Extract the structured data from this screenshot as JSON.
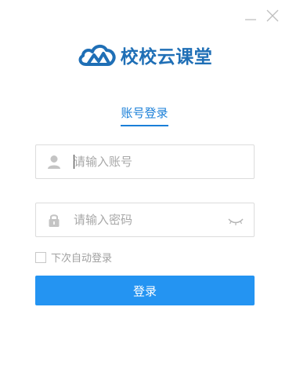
{
  "window": {
    "controls": {
      "minimize_icon": "minimize-icon",
      "close_icon": "close-icon"
    }
  },
  "logo": {
    "text": "校校云课堂",
    "icon": "cloud-logo-icon",
    "color": "#1f6fb6"
  },
  "tab": {
    "label": "账号登录",
    "color": "#1a7fd8"
  },
  "form": {
    "username": {
      "placeholder": "请输入账号",
      "value": "",
      "icon": "user-icon"
    },
    "password": {
      "placeholder": "请输入密码",
      "value": "",
      "icon": "lock-icon",
      "toggle_icon": "eye-closed-icon"
    },
    "auto_login": {
      "label": "下次自动登录",
      "checked": false
    },
    "submit_label": "登录",
    "submit_color": "#2494f2"
  }
}
